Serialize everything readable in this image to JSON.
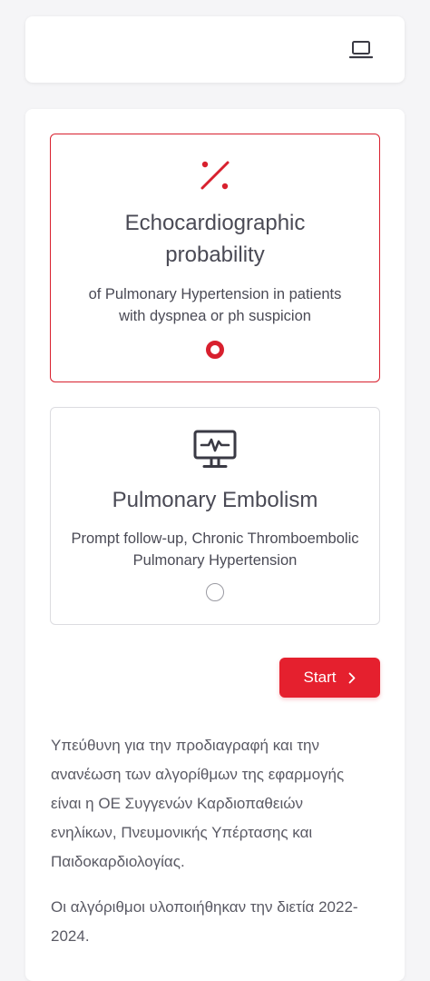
{
  "header": {
    "device_icon": "laptop-icon"
  },
  "options": [
    {
      "icon": "percent-icon",
      "title": "Echocardiographic probability",
      "description": "of Pulmonary Hypertension in patients with dyspnea or ph suspicion",
      "selected": true
    },
    {
      "icon": "monitor-heartbeat-icon",
      "title": "Pulmonary Embolism",
      "description": "Prompt follow-up, Chronic Thromboembolic Pulmonary Hypertension",
      "selected": false
    }
  ],
  "start_button": {
    "label": "Start",
    "icon": "chevron-right-icon"
  },
  "info": {
    "paragraph1": "Υπεύθυνη για την προδιαγραφή και την ανανέωση των αλγορίθμων της εφαρμογής είναι η ΟΕ Συγγενών Καρδιοπαθειών ενηλίκων, Πνευμονικής Υπέρτασης και Παιδοκαρδιολογίας.",
    "paragraph2": "Οι αλγόριθμοι υλοποιήθηκαν την διετία 2022-2024."
  },
  "colors": {
    "accent": "#e5202e",
    "selected_border": "#d8202e",
    "text": "#4a4a55",
    "background": "#f5f5f7"
  }
}
